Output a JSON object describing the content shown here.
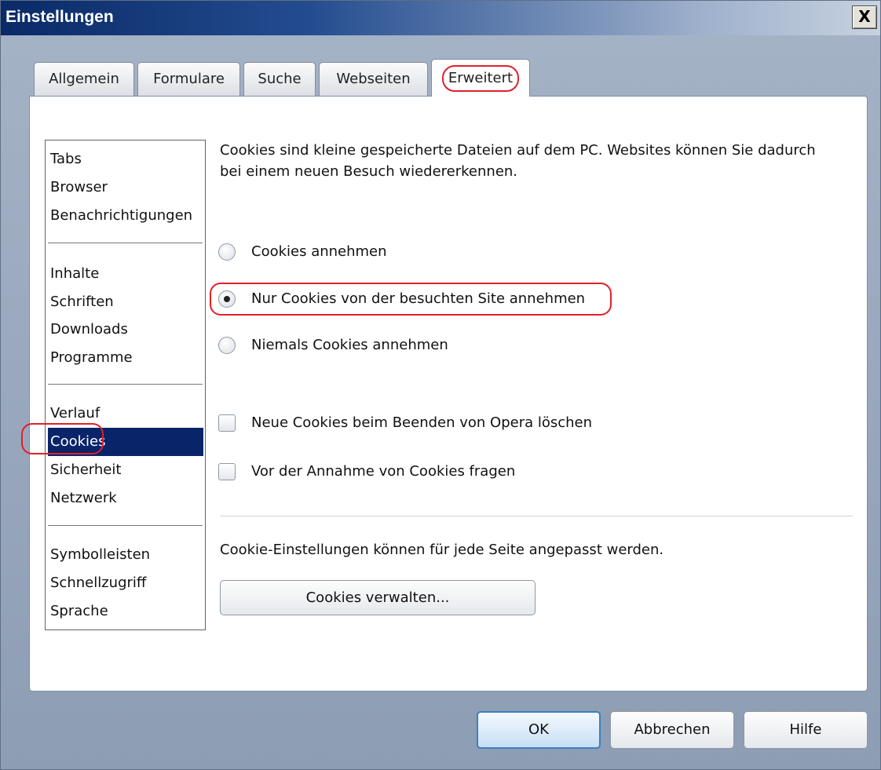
{
  "window": {
    "title": "Einstellungen",
    "close_label": "X"
  },
  "tabs": [
    {
      "label": "Allgemein"
    },
    {
      "label": "Formulare"
    },
    {
      "label": "Suche"
    },
    {
      "label": "Webseiten"
    },
    {
      "label": "Erweitert",
      "active": true
    }
  ],
  "sidebar": {
    "items": [
      "Tabs",
      "Browser",
      "Benachrichtigungen",
      "Inhalte",
      "Schriften",
      "Downloads",
      "Programme",
      "Verlauf",
      "Cookies",
      "Sicherheit",
      "Netzwerk",
      "Symbolleisten",
      "Schnellzugriff",
      "Sprache"
    ],
    "selected": "Cookies"
  },
  "content": {
    "description": "Cookies sind kleine gespeicherte Dateien auf dem PC. Websites können Sie dadurch bei einem neuen Besuch wiedererkennen.",
    "radios": [
      {
        "label": "Cookies annehmen",
        "checked": false
      },
      {
        "label": "Nur Cookies von der besuchten Site annehmen",
        "checked": true
      },
      {
        "label": "Niemals Cookies annehmen",
        "checked": false
      }
    ],
    "checkboxes": [
      {
        "label": "Neue Cookies beim Beenden von Opera löschen",
        "checked": false
      },
      {
        "label": "Vor der Annahme von Cookies fragen",
        "checked": false
      }
    ],
    "info": "Cookie-Einstellungen können für jede Seite angepasst werden.",
    "manage_button": "Cookies verwalten..."
  },
  "footer": {
    "ok": "OK",
    "cancel": "Abbrechen",
    "help": "Hilfe"
  },
  "colors": {
    "highlight": "#e0202a",
    "selection": "#0a246a"
  }
}
